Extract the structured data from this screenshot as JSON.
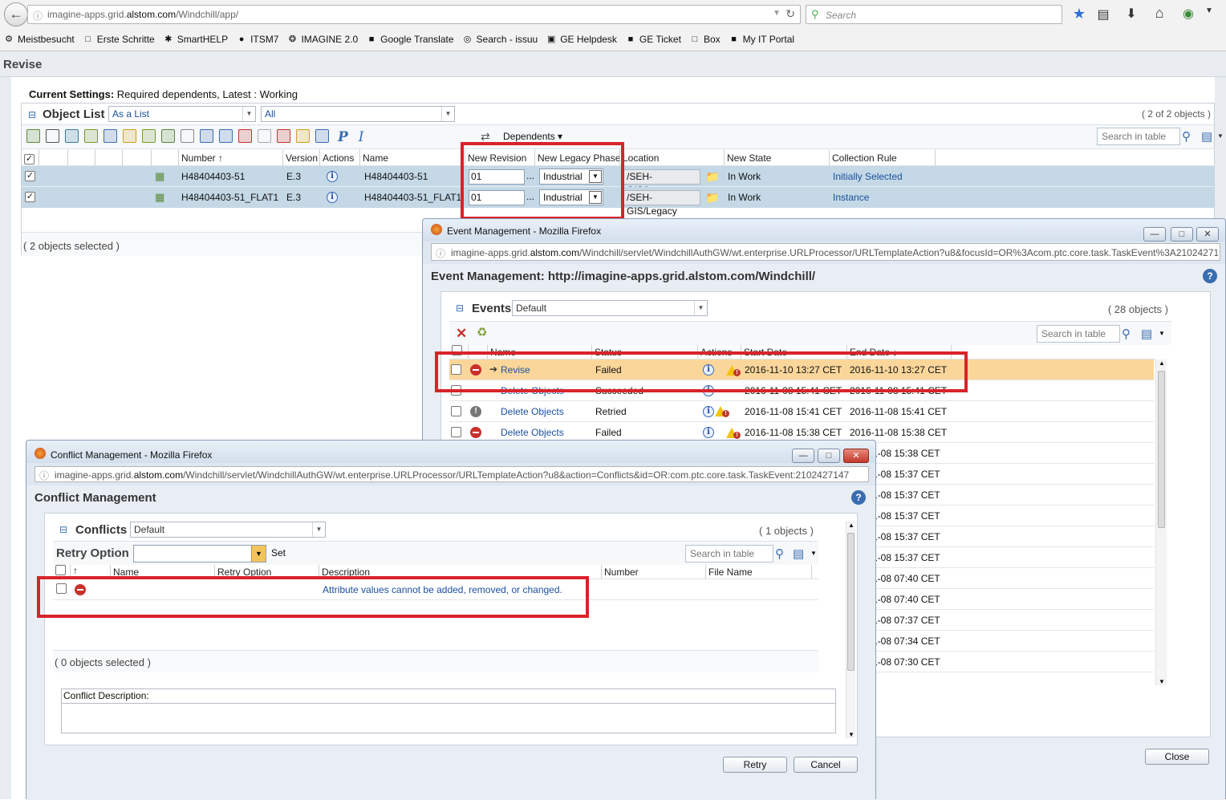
{
  "browser": {
    "url_prefix": "imagine-apps.grid.",
    "url_domain": "alstom.com",
    "url_path": "/Windchill/app/",
    "search_placeholder": "Search",
    "bookmarks": [
      {
        "label": "Meistbesucht",
        "icon": "⚙"
      },
      {
        "label": "Erste Schritte",
        "icon": "□"
      },
      {
        "label": "SmartHELP",
        "icon": "✱"
      },
      {
        "label": "ITSM7",
        "icon": "●"
      },
      {
        "label": "IMAGINE 2.0",
        "icon": "❂"
      },
      {
        "label": "Google Translate",
        "icon": "■"
      },
      {
        "label": "Search - issuu",
        "icon": "◎"
      },
      {
        "label": "GE Helpdesk",
        "icon": "▣"
      },
      {
        "label": "GE Ticket",
        "icon": "■"
      },
      {
        "label": "Box",
        "icon": "□"
      },
      {
        "label": "My IT Portal",
        "icon": "■"
      }
    ]
  },
  "revise": {
    "page_title": "Revise",
    "settings_label": "Current Settings:",
    "settings_value": "Required dependents, Latest : Working",
    "object_list_title": "Object List",
    "view_select": "As a List",
    "filter_select": "All",
    "count": "( 2 of 2 objects )",
    "dependents_label": "Dependents",
    "search_placeholder": "Search in table",
    "columns": [
      "Number",
      "Version",
      "Actions",
      "Name",
      "New Revision",
      "New Legacy Phase",
      "Location",
      "New State",
      "Collection Rule"
    ],
    "rows": [
      {
        "number": "H48404403-51",
        "version": "E.3",
        "name": "H48404403-51",
        "new_revision": "01",
        "phase": "Industrial",
        "location": "/SEH-GIS/Legacy",
        "state": "In Work",
        "rule": "Initially Selected"
      },
      {
        "number": "H48404403-51_FLAT1",
        "version": "E.3",
        "name": "H48404403-51_FLAT1",
        "new_revision": "01",
        "phase": "Industrial",
        "location": "/SEH-GIS/Legacy",
        "state": "In Work",
        "rule": "Instance"
      }
    ],
    "selected_text": "( 2 objects selected )"
  },
  "event_window": {
    "window_title": "Event Management - Mozilla Firefox",
    "url_prefix": "imagine-apps.grid.",
    "url_domain": "alstom.com",
    "url_path": "/Windchill/servlet/WindchillAuthGW/wt.enterprise.URLProcessor/URLTemplateAction?u8&focusId=OR%3Acom.ptc.core.task.TaskEvent%3A21024271",
    "heading": "Event Management: http://imagine-apps.grid.alstom.com/Windchill/",
    "events_title": "Events",
    "view_select": "Default",
    "count": "( 28 objects )",
    "search_placeholder": "Search in table",
    "columns": [
      "Name",
      "Status",
      "Actions",
      "Start Date",
      "End Date"
    ],
    "rows": [
      {
        "icon": "stop",
        "name": "Revise",
        "status": "Failed",
        "actions": "info-warn",
        "start": "2016-11-10 13:27 CET",
        "end": "2016-11-10 13:27 CET",
        "highlight": true
      },
      {
        "icon": "none",
        "name": "Delete Objects",
        "status": "Succeeded",
        "actions": "info",
        "start": "2016-11-08 15:41 CET",
        "end": "2016-11-08 15:41 CET"
      },
      {
        "icon": "retry",
        "name": "Delete Objects",
        "status": "Retried",
        "actions": "info-warn",
        "start": "2016-11-08 15:41 CET",
        "end": "2016-11-08 15:41 CET"
      },
      {
        "icon": "stop",
        "name": "Delete Objects",
        "status": "Failed",
        "actions": "info-warn",
        "start": "2016-11-08 15:38 CET",
        "end": "2016-11-08 15:38 CET"
      }
    ],
    "partial_end_dates": [
      "1-08 15:38 CET",
      "1-08 15:37 CET",
      "1-08 15:37 CET",
      "1-08 15:37 CET",
      "1-08 15:37 CET",
      "1-08 15:37 CET",
      "1-08 07:40 CET",
      "1-08 07:40 CET",
      "1-08 07:37 CET",
      "1-08 07:34 CET",
      "1-08 07:30 CET"
    ],
    "close_label": "Close"
  },
  "conflict_window": {
    "window_title": "Conflict Management - Mozilla Firefox",
    "url_prefix": "imagine-apps.grid.",
    "url_domain": "alstom.com",
    "url_path": "/Windchill/servlet/WindchillAuthGW/wt.enterprise.URLProcessor/URLTemplateAction?u8&action=Conflicts&id=OR:com.ptc.core.task.TaskEvent:2102427147",
    "heading": "Conflict Management",
    "conflicts_title": "Conflicts",
    "view_select": "Default",
    "count": "( 1 objects )",
    "retry_option_label": "Retry Option",
    "set_label": "Set",
    "search_placeholder": "Search in table",
    "columns": [
      "Name",
      "Retry Option",
      "Description",
      "Number",
      "File Name"
    ],
    "row_description": "Attribute values cannot be added, removed, or changed.",
    "selected_text": "( 0 objects selected )",
    "conflict_description_label": "Conflict Description:",
    "retry_label": "Retry",
    "cancel_label": "Cancel"
  }
}
